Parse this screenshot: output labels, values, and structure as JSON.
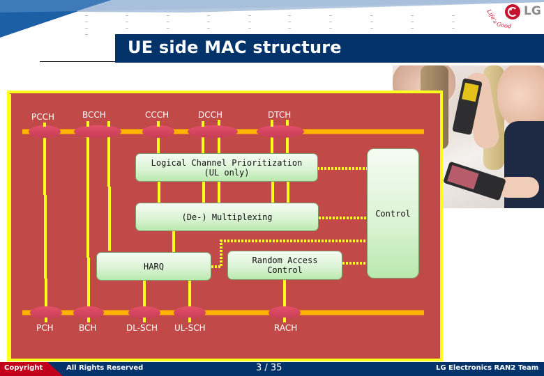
{
  "slide": {
    "title": "UE side MAC structure",
    "logo": {
      "brand": "LG",
      "slogan_a": "Life's",
      "slogan_b": "Good"
    },
    "photo_description": "Two young women holding LG slider mobile phones"
  },
  "diagram": {
    "logical_channels": [
      "PCCH",
      "BCCH",
      "CCCH",
      "DCCH",
      "DTCH"
    ],
    "transport_channels": [
      "PCH",
      "BCH",
      "DL-SCH",
      "UL-SCH",
      "RACH"
    ],
    "blocks": {
      "lcp_line1": "Logical Channel Prioritization",
      "lcp_line2": "(UL only)",
      "mux": "(De-) Multiplexing",
      "harq": "HARQ",
      "rac_line1": "Random Access",
      "rac_line2": "Control",
      "control": "Control"
    },
    "colors": {
      "background": "#c14a49",
      "border": "#ffff1e",
      "bus": "#ffb400",
      "line": "#ffff1e",
      "ellipse": "#d9425c",
      "box": "#dcf4d6"
    }
  },
  "footer": {
    "copyright": "Copyright",
    "rights": "All Rights Reserved",
    "page": "3 / 35",
    "team": "LG Electronics RAN2 Team"
  }
}
